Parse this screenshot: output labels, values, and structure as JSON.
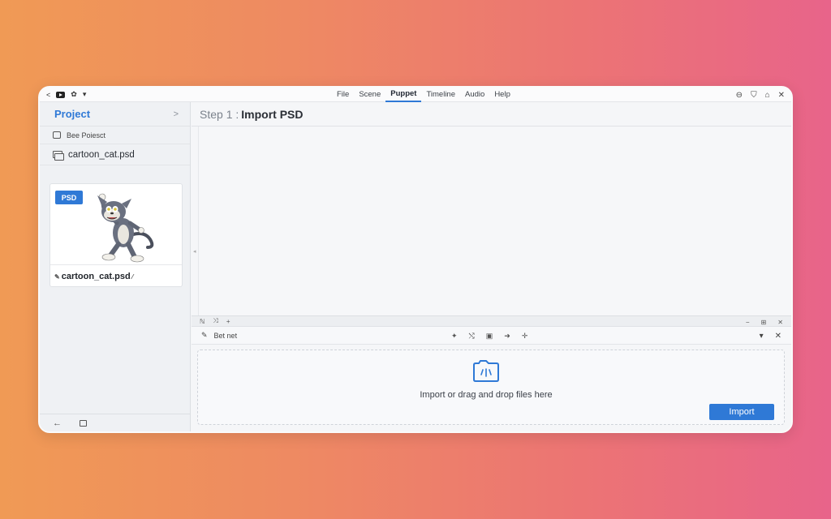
{
  "topbar": {
    "menu": [
      {
        "label": "File",
        "active": false
      },
      {
        "label": "Scene",
        "active": false
      },
      {
        "label": "Puppet",
        "active": true
      },
      {
        "label": "Timeline",
        "active": false
      },
      {
        "label": "Audio",
        "active": false
      },
      {
        "label": "Help",
        "active": false
      }
    ],
    "icons_left": [
      "back-icon",
      "youtube-icon",
      "palette-icon",
      "chevron-down-icon"
    ],
    "icons_right": [
      "zoom-icon",
      "shield-icon",
      "home-icon",
      "close-icon"
    ]
  },
  "sidebar": {
    "title": "Project",
    "chevron": ">",
    "new_project_label": "Bee Poiesct",
    "file_label": "cartoon_cat.psd",
    "card": {
      "badge": "PSD",
      "caption": "cartoon_cat.psd"
    }
  },
  "main": {
    "step_label": "Step 1 :",
    "step_title": "Import PSD",
    "panel": {
      "tab_plus": "+",
      "bar_label": "Bet net",
      "drop_text": "Import or drag and drop files here",
      "import_label": "Import"
    }
  },
  "colors": {
    "accent": "#2f79d6",
    "background_gradient_start": "#f09a55",
    "background_gradient_end": "#e8648a"
  }
}
